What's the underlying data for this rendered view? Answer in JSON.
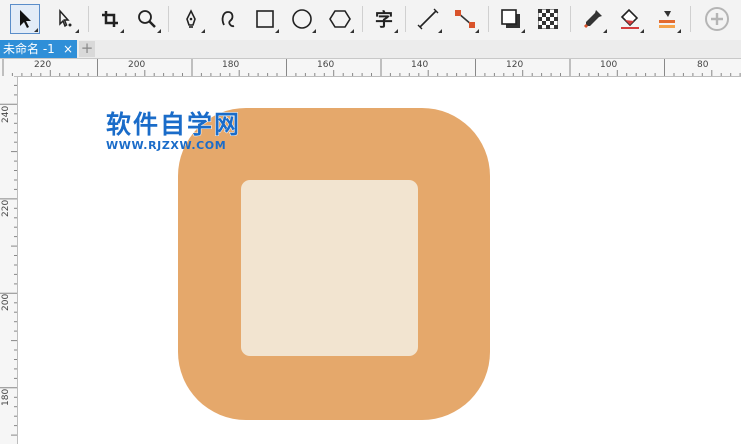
{
  "toolbar": {
    "tools": [
      {
        "name": "pick-tool",
        "icon": "arrow-pointer-icon"
      },
      {
        "name": "shape-tool",
        "icon": "node-edit-icon"
      },
      {
        "name": "crop-tool",
        "icon": "crop-icon"
      },
      {
        "name": "zoom-tool",
        "icon": "magnifier-icon"
      },
      {
        "name": "freehand-tool",
        "icon": "pen-nib-icon"
      },
      {
        "name": "artistic-media-tool",
        "icon": "brush-stroke-icon"
      },
      {
        "name": "rectangle-tool",
        "icon": "rectangle-icon"
      },
      {
        "name": "ellipse-tool",
        "icon": "ellipse-icon"
      },
      {
        "name": "polygon-tool",
        "icon": "hexagon-icon"
      },
      {
        "name": "text-tool",
        "icon": "text-icon",
        "glyph": "字"
      },
      {
        "name": "parallel-dimension-tool",
        "icon": "dimension-line-icon"
      },
      {
        "name": "connector-tool",
        "icon": "connector-icon"
      },
      {
        "name": "drop-shadow-tool",
        "icon": "drop-shadow-icon"
      },
      {
        "name": "transparency-tool",
        "icon": "checkerboard-icon"
      },
      {
        "name": "color-eyedropper-tool",
        "icon": "eyedropper-icon"
      },
      {
        "name": "interactive-fill-tool",
        "icon": "paint-bucket-icon"
      },
      {
        "name": "smart-fill-tool",
        "icon": "smart-fill-icon"
      },
      {
        "name": "add-tool-button",
        "icon": "plus-circle-icon"
      }
    ]
  },
  "tabs": {
    "document_tab": "未命名 -1",
    "close_glyph": "×",
    "add_glyph": "+"
  },
  "rulers": {
    "corner_label": "∧",
    "horizontal_labels": [
      "220",
      "200",
      "180",
      "160",
      "140",
      "120",
      "100",
      "80"
    ],
    "vertical_labels": [
      "240",
      "220",
      "200",
      "180"
    ]
  },
  "canvas": {
    "outer_fill": "#e5a86b",
    "inner_fill": "#f2e4d0",
    "watermark_title": "软件自学网",
    "watermark_url": "WWW.RJZXW.COM",
    "watermark_color": "#1a6cc9"
  }
}
